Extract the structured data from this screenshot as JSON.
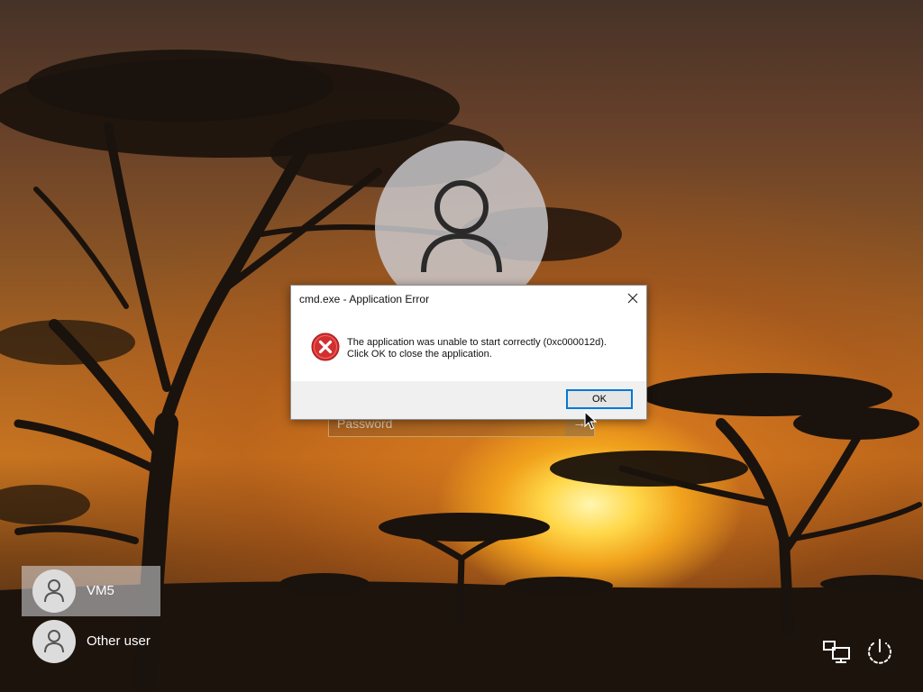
{
  "login": {
    "password_placeholder": "Password",
    "submit_glyph": "→"
  },
  "dialog": {
    "title": "cmd.exe - Application Error",
    "close_glyph": "✕",
    "message_line1": "The application was unable to start correctly (0xc000012d).",
    "message_line2": "Click OK to close the application.",
    "ok_label": "OK",
    "icon": "error-icon",
    "error_color": "#d32f2f"
  },
  "users": [
    {
      "name": "VM5",
      "selected": true
    },
    {
      "name": "Other user",
      "selected": false
    }
  ],
  "system_icons": [
    "network-icon",
    "power-icon"
  ]
}
